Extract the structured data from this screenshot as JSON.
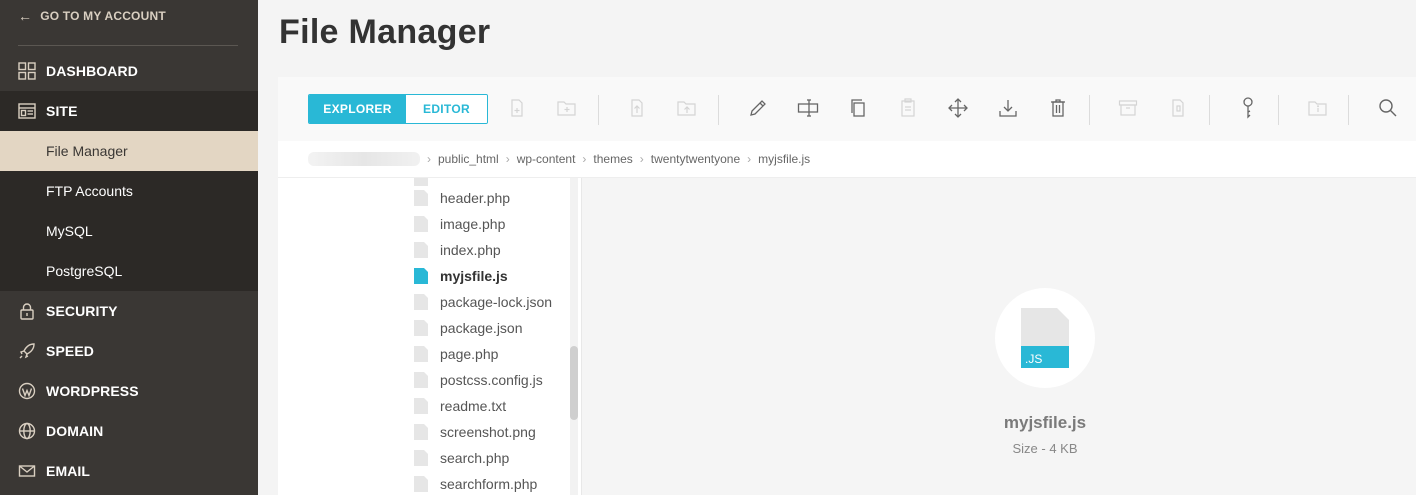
{
  "sidebar": {
    "back_label": "GO TO MY ACCOUNT",
    "nav": {
      "dashboard": "DASHBOARD",
      "site": "SITE",
      "security": "SECURITY",
      "speed": "SPEED",
      "wordpress": "WORDPRESS",
      "domain": "DOMAIN",
      "email": "EMAIL"
    },
    "site_items": [
      "File Manager",
      "FTP Accounts",
      "MySQL",
      "PostgreSQL"
    ],
    "active_item": "File Manager"
  },
  "page": {
    "title": "File Manager"
  },
  "toolbar": {
    "modes": {
      "explorer": "EXPLORER",
      "editor": "EDITOR"
    },
    "active_mode": "EXPLORER",
    "icons": [
      "new-file-icon",
      "new-folder-icon",
      "upload-file-icon",
      "upload-folder-icon",
      "rename-icon",
      "rename-field-icon",
      "copy-icon",
      "paste-icon",
      "move-icon",
      "download-icon",
      "delete-icon",
      "archive-icon",
      "extract-icon",
      "permissions-key-icon",
      "folder-info-icon",
      "search-icon"
    ]
  },
  "breadcrumb": [
    "public_html",
    "wp-content",
    "themes",
    "twentytwentyone",
    "myjsfile.js"
  ],
  "tree": {
    "files": [
      "header.php",
      "image.php",
      "index.php",
      "myjsfile.js",
      "package-lock.json",
      "package.json",
      "page.php",
      "postcss.config.js",
      "readme.txt",
      "screenshot.png",
      "search.php",
      "searchform.php"
    ],
    "selected": "myjsfile.js"
  },
  "preview": {
    "file_name": "myjsfile.js",
    "size": "Size - 4 KB",
    "badge": ".JS"
  },
  "colors": {
    "accent": "#29b8d6",
    "sidebar_bg": "#3a3734",
    "active_item_bg": "#e3d6c3"
  }
}
